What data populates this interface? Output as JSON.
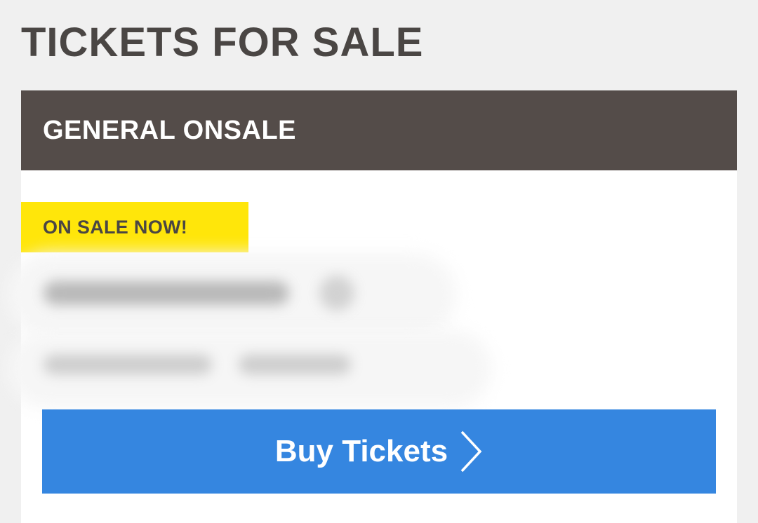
{
  "page": {
    "title": "TICKETS FOR SALE"
  },
  "card": {
    "header_title": "GENERAL ONSALE",
    "status_badge": "ON SALE NOW!",
    "buy_button_label": "Buy Tickets",
    "buy_button_icon": "chevron-right-icon"
  },
  "colors": {
    "background": "#f0f0f0",
    "header_bg": "#544c49",
    "badge_bg": "#ffe60a",
    "button_bg": "#3586e0",
    "title_text": "#4a4644"
  }
}
